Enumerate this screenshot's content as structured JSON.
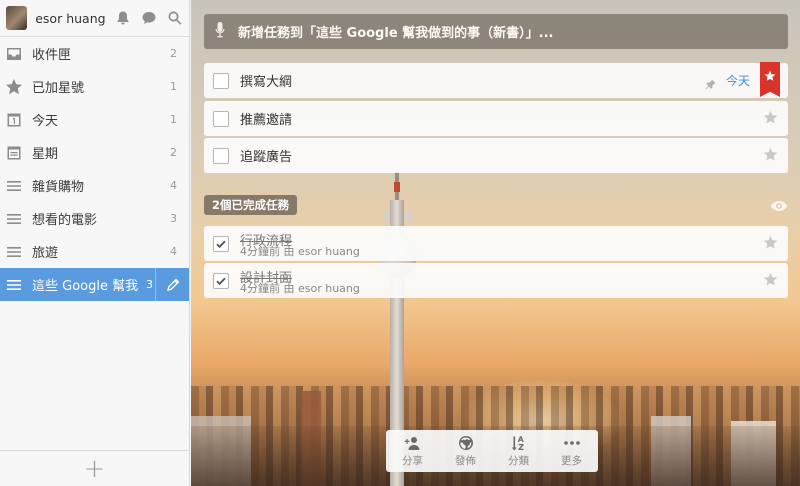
{
  "user": {
    "name": "esor huang"
  },
  "sidebar": {
    "items": [
      {
        "label": "收件匣",
        "count": "2",
        "icon": "inbox-icon"
      },
      {
        "label": "已加星號",
        "count": "1",
        "icon": "star-icon"
      },
      {
        "label": "今天",
        "count": "1",
        "icon": "calendar-day-icon"
      },
      {
        "label": "星期",
        "count": "2",
        "icon": "calendar-week-icon"
      },
      {
        "label": "雜貨購物",
        "count": "4",
        "icon": "list-icon"
      },
      {
        "label": "想看的電影",
        "count": "3",
        "icon": "list-icon"
      },
      {
        "label": "旅遊",
        "count": "4",
        "icon": "list-icon"
      },
      {
        "label": "這些 Google 幫我",
        "count": "3",
        "icon": "list-icon",
        "active": true
      }
    ],
    "add_label": "+"
  },
  "main": {
    "add_placeholder": "新增任務到「這些 Google 幫我做到的事（新書）」...",
    "tasks": [
      {
        "title": "撰寫大綱",
        "due": "今天",
        "starred": true
      },
      {
        "title": "推薦邀請",
        "starred": false
      },
      {
        "title": "追蹤廣告",
        "starred": false
      }
    ],
    "completed_label": "2個已完成任務",
    "completed": [
      {
        "title": "行政流程",
        "meta": "4分鐘前 由 esor huang"
      },
      {
        "title": "設計封面",
        "meta": "4分鐘前 由 esor huang"
      }
    ]
  },
  "toolbar": {
    "share": "分享",
    "publish": "發佈",
    "sort": "分類",
    "more": "更多"
  },
  "colors": {
    "accent": "#5a9be0",
    "flag": "#d9342b",
    "due": "#3b8fd6"
  }
}
